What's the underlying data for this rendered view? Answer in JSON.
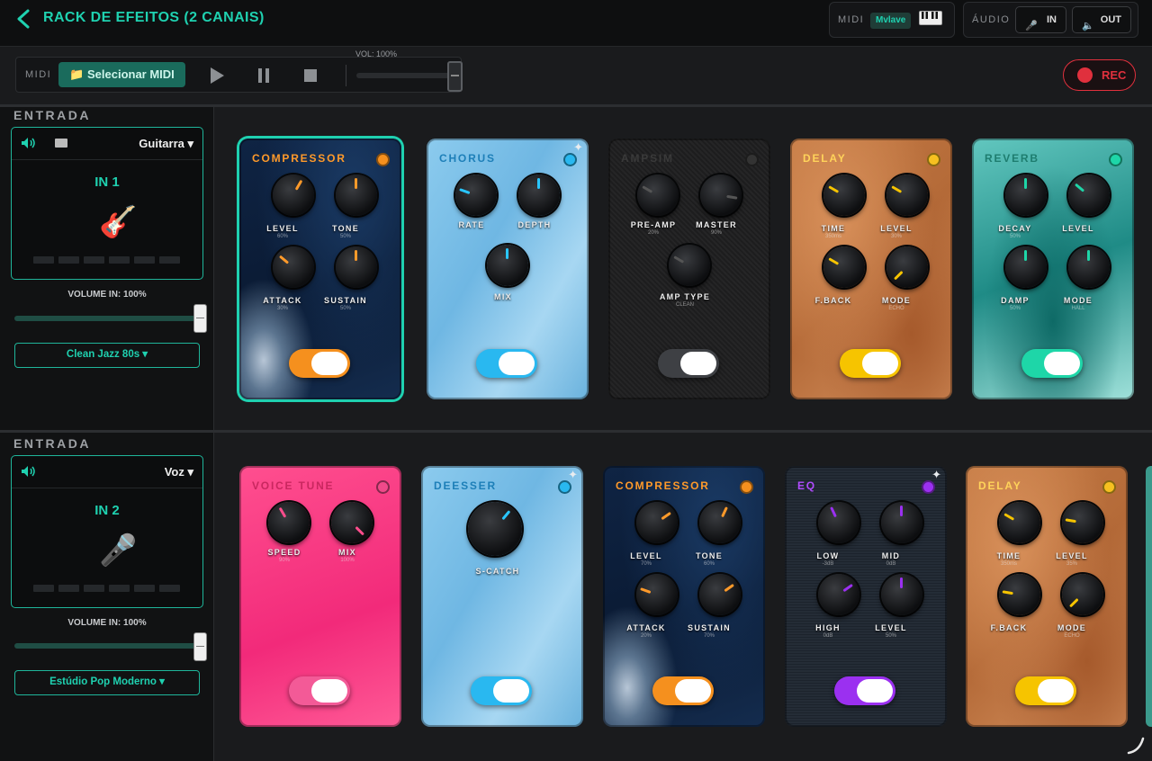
{
  "header": {
    "title": "RACK DE EFEITOS (2 CANAIS)",
    "midi_label": "MIDI",
    "midi_device": "Mvlave",
    "audio_label": "ÁUDIO",
    "in_label": "IN",
    "out_label": "OUT"
  },
  "transport": {
    "midi_label": "MIDI",
    "select_midi": "📁 Selecionar MIDI",
    "volume_label": "VOL: 100%",
    "volume_value": 1.0,
    "rec_label": "REC"
  },
  "channels": [
    {
      "section_label": "ENTRADA",
      "instrument": "Guitarra ▾",
      "input_name": "IN 1",
      "instrument_glyph": "🎸",
      "volume_label": "VOLUME IN: 100%",
      "volume_value": 1.0,
      "preset": "Clean Jazz 80s ▾",
      "pedals": [
        {
          "name": "COMPRESSOR",
          "theme": "navy",
          "led": "#f5901e",
          "selected": true,
          "toggle": "#f5901e",
          "name_color": "#ff9a2a",
          "knobs": [
            {
              "label": "LEVEL",
              "value": "60%",
              "angle": 30,
              "color": "#ff9a2a"
            },
            {
              "label": "TONE",
              "value": "50%",
              "angle": 0,
              "color": "#ff9a2a"
            },
            {
              "label": "ATTACK",
              "value": "30%",
              "angle": -50,
              "color": "#ff9a2a"
            },
            {
              "label": "SUSTAIN",
              "value": "50%",
              "angle": 0,
              "color": "#ff9a2a"
            }
          ]
        },
        {
          "name": "CHORUS",
          "theme": "sky",
          "led": "#29b8f0",
          "star": true,
          "toggle": "#29b8f0",
          "name_color": "#1d7fb8",
          "knobs": [
            {
              "label": "RATE",
              "value": "",
              "angle": -70,
              "color": "#29c6ff"
            },
            {
              "label": "DEPTH",
              "value": "",
              "angle": 0,
              "color": "#29c6ff"
            },
            {
              "label": "MIX",
              "value": "",
              "angle": 0,
              "color": "#29c6ff"
            }
          ]
        },
        {
          "name": "AMPSIM",
          "theme": "black",
          "led": "#333",
          "toggle": "#3e4044",
          "name_color": "#3a3a3a",
          "knobs": [
            {
              "label": "PRE-AMP",
              "value": "20%",
              "angle": -60,
              "color": "#555"
            },
            {
              "label": "MASTER",
              "value": "90%",
              "angle": 100,
              "color": "#555"
            },
            {
              "label": "AMP TYPE",
              "value": "CLEAN",
              "angle": -60,
              "color": "#555"
            }
          ]
        },
        {
          "name": "DELAY",
          "theme": "copper",
          "led": "#f6c020",
          "toggle": "#f6c400",
          "name_color": "#ffd35a",
          "knobs": [
            {
              "label": "TIME",
              "value": "350ms",
              "angle": -60,
              "color": "#f6c400"
            },
            {
              "label": "LEVEL",
              "value": "30%",
              "angle": -60,
              "color": "#f6c400"
            },
            {
              "label": "F.BACK",
              "value": "",
              "angle": -60,
              "color": "#f6c400"
            },
            {
              "label": "MODE",
              "value": "ECHO",
              "angle": -135,
              "color": "#f6c400"
            }
          ]
        },
        {
          "name": "REVERB",
          "theme": "teal",
          "led": "#1ed6a8",
          "toggle": "#1ed6a8",
          "name_color": "#1e7d6f",
          "knobs": [
            {
              "label": "DECAY",
              "value": "50%",
              "angle": 0,
              "color": "#1ed6a8"
            },
            {
              "label": "LEVEL",
              "value": "",
              "angle": -50,
              "color": "#1ed6a8"
            },
            {
              "label": "DAMP",
              "value": "50%",
              "angle": 0,
              "color": "#1ed6a8"
            },
            {
              "label": "MODE",
              "value": "HALL",
              "angle": 0,
              "color": "#1ed6a8"
            }
          ]
        }
      ]
    },
    {
      "section_label": "ENTRADA",
      "instrument": "Voz ▾",
      "input_name": "IN 2",
      "instrument_glyph": "🎤",
      "volume_label": "VOLUME IN: 100%",
      "volume_value": 1.0,
      "preset": "Estúdio Pop Moderno ▾",
      "pedals": [
        {
          "name": "VOICE TUNE",
          "theme": "pink",
          "led": "#f04a8a",
          "toggle": "#f35a97",
          "name_color": "#c9275f",
          "knobs": [
            {
              "label": "SPEED",
              "value": "90%",
              "angle": -30,
              "color": "#ff4d8d"
            },
            {
              "label": "MIX",
              "value": "100%",
              "angle": 135,
              "color": "#ff4d8d"
            }
          ]
        },
        {
          "name": "DEESSER",
          "theme": "sky",
          "led": "#29b8f0",
          "star": true,
          "toggle": "#29b8f0",
          "name_color": "#1d7fb8",
          "knobs": [
            {
              "label": "S-CATCH",
              "value": "",
              "angle": 40,
              "color": "#29c6ff",
              "big": true
            }
          ]
        },
        {
          "name": "COMPRESSOR",
          "theme": "navy",
          "led": "#f5901e",
          "toggle": "#f5901e",
          "name_color": "#ff9a2a",
          "knobs": [
            {
              "label": "LEVEL",
              "value": "70%",
              "angle": 55,
              "color": "#ff9a2a"
            },
            {
              "label": "TONE",
              "value": "60%",
              "angle": 25,
              "color": "#ff9a2a"
            },
            {
              "label": "ATTACK",
              "value": "20%",
              "angle": -70,
              "color": "#ff9a2a"
            },
            {
              "label": "SUSTAIN",
              "value": "70%",
              "angle": 55,
              "color": "#ff9a2a"
            }
          ]
        },
        {
          "name": "EQ",
          "theme": "steel",
          "led": "#9b30f0",
          "star": true,
          "toggle": "#9b30f0",
          "name_color": "#b14cff",
          "knobs": [
            {
              "label": "LOW",
              "value": "-3dB",
              "angle": -25,
              "color": "#9b30f0"
            },
            {
              "label": "MID",
              "value": "0dB",
              "angle": 0,
              "color": "#9b30f0"
            },
            {
              "label": "HIGH",
              "value": "0dB",
              "angle": 55,
              "color": "#9b30f0"
            },
            {
              "label": "LEVEL",
              "value": "50%",
              "angle": 0,
              "color": "#9b30f0"
            }
          ]
        },
        {
          "name": "DELAY",
          "theme": "copper",
          "led": "#f6c020",
          "toggle": "#f6c400",
          "name_color": "#ffd35a",
          "knobs": [
            {
              "label": "TIME",
              "value": "350ms",
              "angle": -60,
              "color": "#f6c400"
            },
            {
              "label": "LEVEL",
              "value": "35%",
              "angle": -80,
              "color": "#f6c400"
            },
            {
              "label": "F.BACK",
              "value": "",
              "angle": -80,
              "color": "#f6c400"
            },
            {
              "label": "MODE",
              "value": "ECHO",
              "angle": -135,
              "color": "#f6c400"
            }
          ]
        }
      ]
    }
  ]
}
